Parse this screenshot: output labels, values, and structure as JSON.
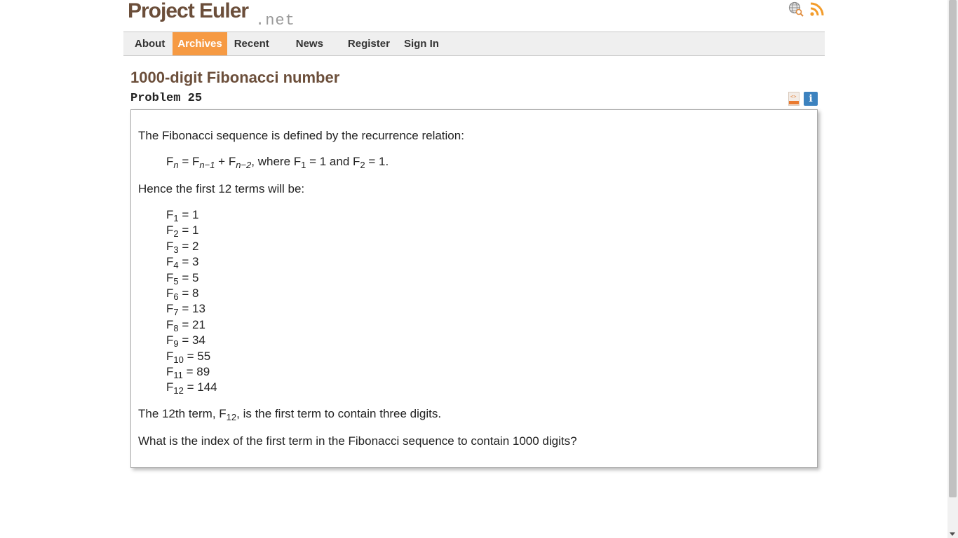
{
  "header": {
    "logo_main": "Project Euler",
    "logo_suffix": ".net",
    "icons": [
      "globe-search-icon",
      "rss-icon"
    ]
  },
  "nav": {
    "items": [
      {
        "label": "About",
        "active": false
      },
      {
        "label": "Archives",
        "active": true
      },
      {
        "label": "Recent",
        "active": false
      },
      {
        "label": "News",
        "active": false
      },
      {
        "label": "Register",
        "active": false
      },
      {
        "label": "Sign In",
        "active": false
      }
    ]
  },
  "problem": {
    "title": "1000-digit Fibonacci number",
    "number": "Problem 25",
    "icons": [
      "html-icon",
      "info-icon"
    ],
    "intro": "The Fibonacci sequence is defined by the recurrence relation:",
    "recurrence": {
      "lhs": "F",
      "lhs_sub": "n",
      "eq": " = F",
      "t1_sub": "n−1",
      "plus": " + F",
      "t2_sub": "n−2",
      "where": ", where F",
      "w1_sub": "1",
      "and": " = 1 and F",
      "w2_sub": "2",
      "end": " = 1."
    },
    "hence": "Hence the first 12 terms will be:",
    "terms": [
      {
        "sub": "1",
        "value": " = 1"
      },
      {
        "sub": "2",
        "value": " = 1"
      },
      {
        "sub": "3",
        "value": " = 2"
      },
      {
        "sub": "4",
        "value": " = 3"
      },
      {
        "sub": "5",
        "value": " = 5"
      },
      {
        "sub": "6",
        "value": " = 8"
      },
      {
        "sub": "7",
        "value": " = 13"
      },
      {
        "sub": "8",
        "value": " = 21"
      },
      {
        "sub": "9",
        "value": " = 34"
      },
      {
        "sub": "10",
        "value": " = 55"
      },
      {
        "sub": "11",
        "value": " = 89"
      },
      {
        "sub": "12",
        "value": " = 144"
      }
    ],
    "term_letter": "F",
    "twelfth": {
      "pre": "The 12th term, F",
      "sub": "12",
      "post": ", is the first term to contain three digits."
    },
    "question": "What is the index of the first term in the Fibonacci sequence to contain 1000 digits?"
  },
  "colors": {
    "brand": "#6b4e3a",
    "accent": "#f69a43",
    "info_blue": "#3c82bf"
  }
}
